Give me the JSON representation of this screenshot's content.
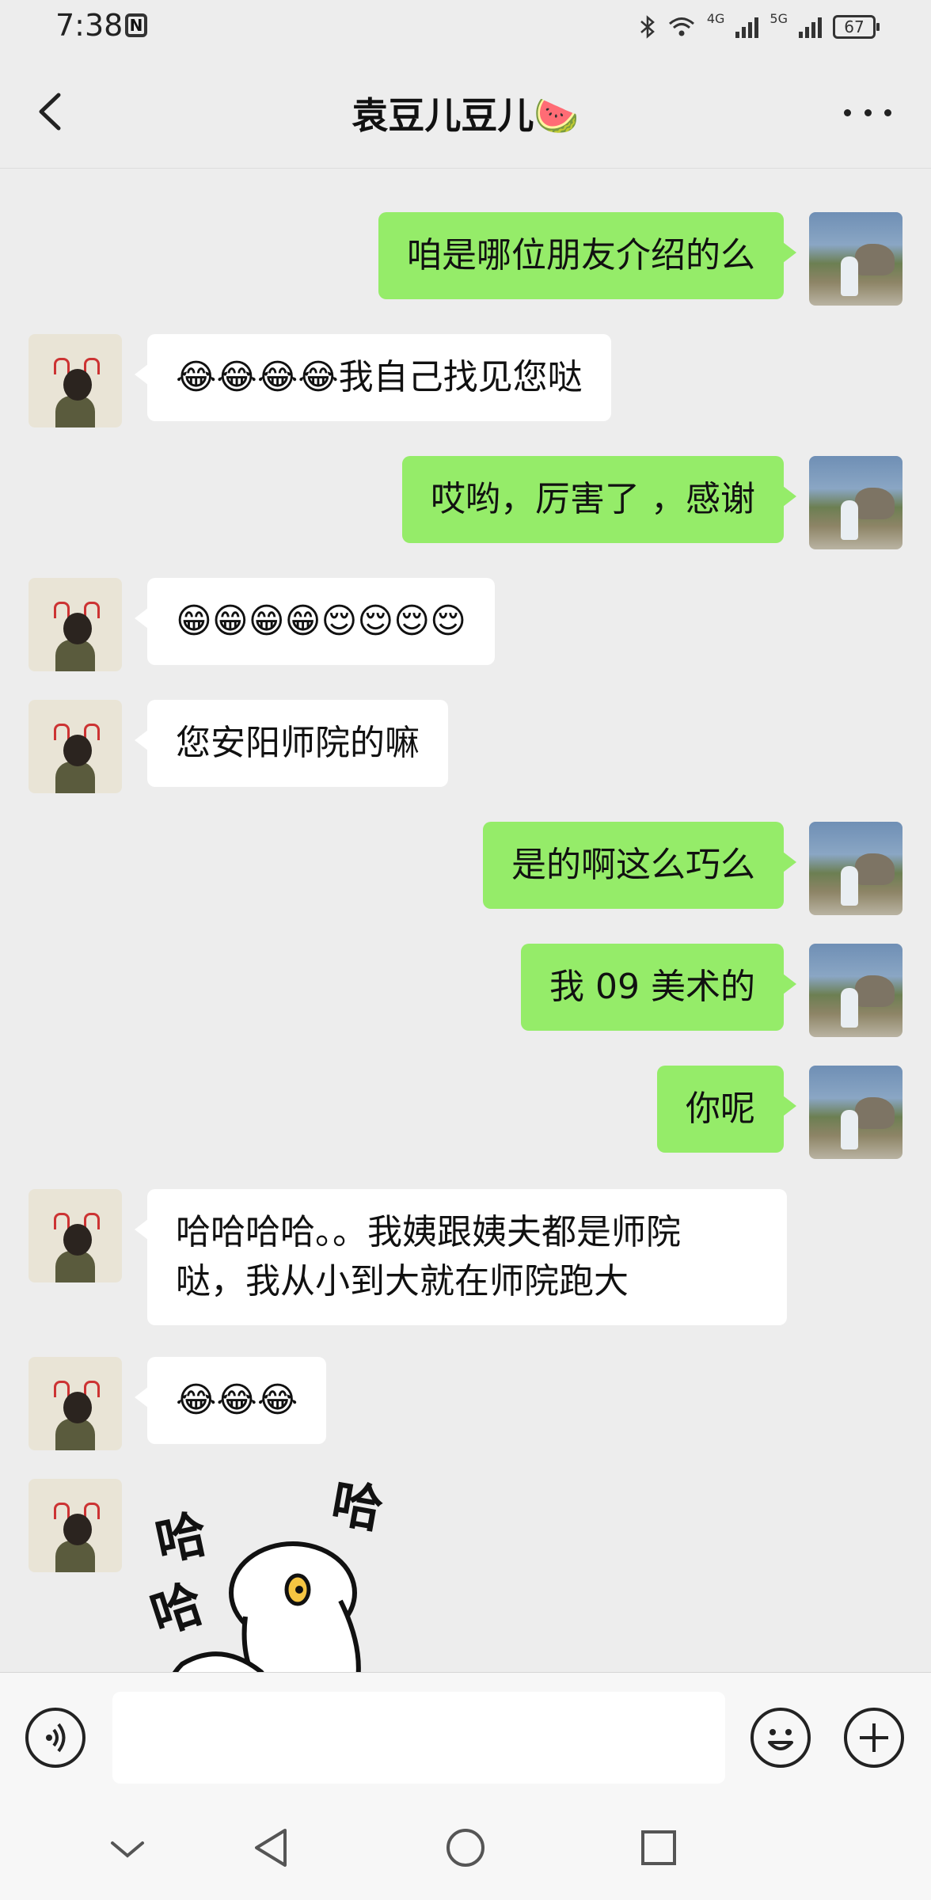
{
  "status_bar": {
    "time": "7:38",
    "nfc_label": "N",
    "network_1": "4G",
    "network_2": "5G",
    "battery": "67"
  },
  "header": {
    "title": "袁豆儿豆儿🍉"
  },
  "messages": [
    {
      "from": "me",
      "text": "咱是哪位朋友介绍的么"
    },
    {
      "from": "them",
      "text": "😂😂😂😂我自己找见您哒"
    },
    {
      "from": "me",
      "text": "哎哟，厉害了 ，感谢"
    },
    {
      "from": "them",
      "text": "😁😁😁😁😌😌😌😌"
    },
    {
      "from": "them",
      "text": "您安阳师院的嘛"
    },
    {
      "from": "me",
      "text": "是的啊这么巧么"
    },
    {
      "from": "me",
      "text": "我 09 美术的"
    },
    {
      "from": "me",
      "text": "你呢"
    },
    {
      "from": "them",
      "text": "哈哈哈哈。。我姨跟姨夫都是师院\n哒，我从小到大就在师院跑大"
    },
    {
      "from": "them",
      "text": "😂😂😂"
    },
    {
      "from": "them",
      "type": "sticker",
      "sticker_text_1": "哈",
      "sticker_text_2": "哈"
    }
  ],
  "input": {
    "value": "",
    "placeholder": ""
  },
  "icons": {
    "back": "chevron-left-icon",
    "more": "more-dots-icon",
    "voice": "voice-icon",
    "emoji": "emoji-icon",
    "plus": "plus-icon",
    "nav_down": "chevron-down-icon",
    "nav_back": "triangle-back-icon",
    "nav_home": "circle-home-icon",
    "nav_recent": "square-recent-icon"
  },
  "colors": {
    "my_bubble": "#95ec69",
    "their_bubble": "#ffffff",
    "background": "#ededed"
  }
}
